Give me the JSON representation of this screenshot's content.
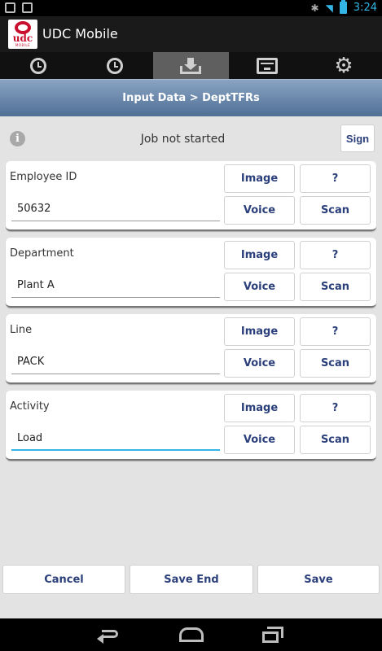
{
  "status_bar": {
    "time": "3:24",
    "icons": [
      "image-notification-icon",
      "clipboard-icon",
      "bluetooth-icon",
      "wifi-icon",
      "battery-icon"
    ]
  },
  "app": {
    "title": "UDC Mobile",
    "logo_text": "udc",
    "logo_subtext": "MOBILE"
  },
  "tabs": [
    {
      "icon": "clock-icon",
      "active": false
    },
    {
      "icon": "clock-icon",
      "active": false
    },
    {
      "icon": "download-tray-icon",
      "active": true
    },
    {
      "icon": "inbox-icon",
      "active": false
    },
    {
      "icon": "gear-icon",
      "active": false
    }
  ],
  "header": {
    "breadcrumb": "Input Data > DeptTFRs"
  },
  "job": {
    "status": "Job not started",
    "sign_label": "Sign",
    "info_glyph": "i"
  },
  "fields": [
    {
      "label": "Employee ID",
      "value": "50632",
      "image_label": "Image",
      "help_label": "?",
      "voice_label": "Voice",
      "scan_label": "Scan"
    },
    {
      "label": "Department",
      "value": "Plant A",
      "image_label": "Image",
      "help_label": "?",
      "voice_label": "Voice",
      "scan_label": "Scan"
    },
    {
      "label": "Line",
      "value": "PACK",
      "image_label": "Image",
      "help_label": "?",
      "voice_label": "Voice",
      "scan_label": "Scan"
    },
    {
      "label": "Activity",
      "value": "Load",
      "image_label": "Image",
      "help_label": "?",
      "voice_label": "Voice",
      "scan_label": "Scan",
      "focused": true
    }
  ],
  "actions": {
    "cancel_label": "Cancel",
    "save_end_label": "Save End",
    "save_label": "Save"
  },
  "colors": {
    "accent": "#33b5e5",
    "button_text": "#2b3f7a",
    "header_top": "#8aa4c3",
    "header_bottom": "#4f6f96",
    "logo_red": "#c8102e"
  }
}
